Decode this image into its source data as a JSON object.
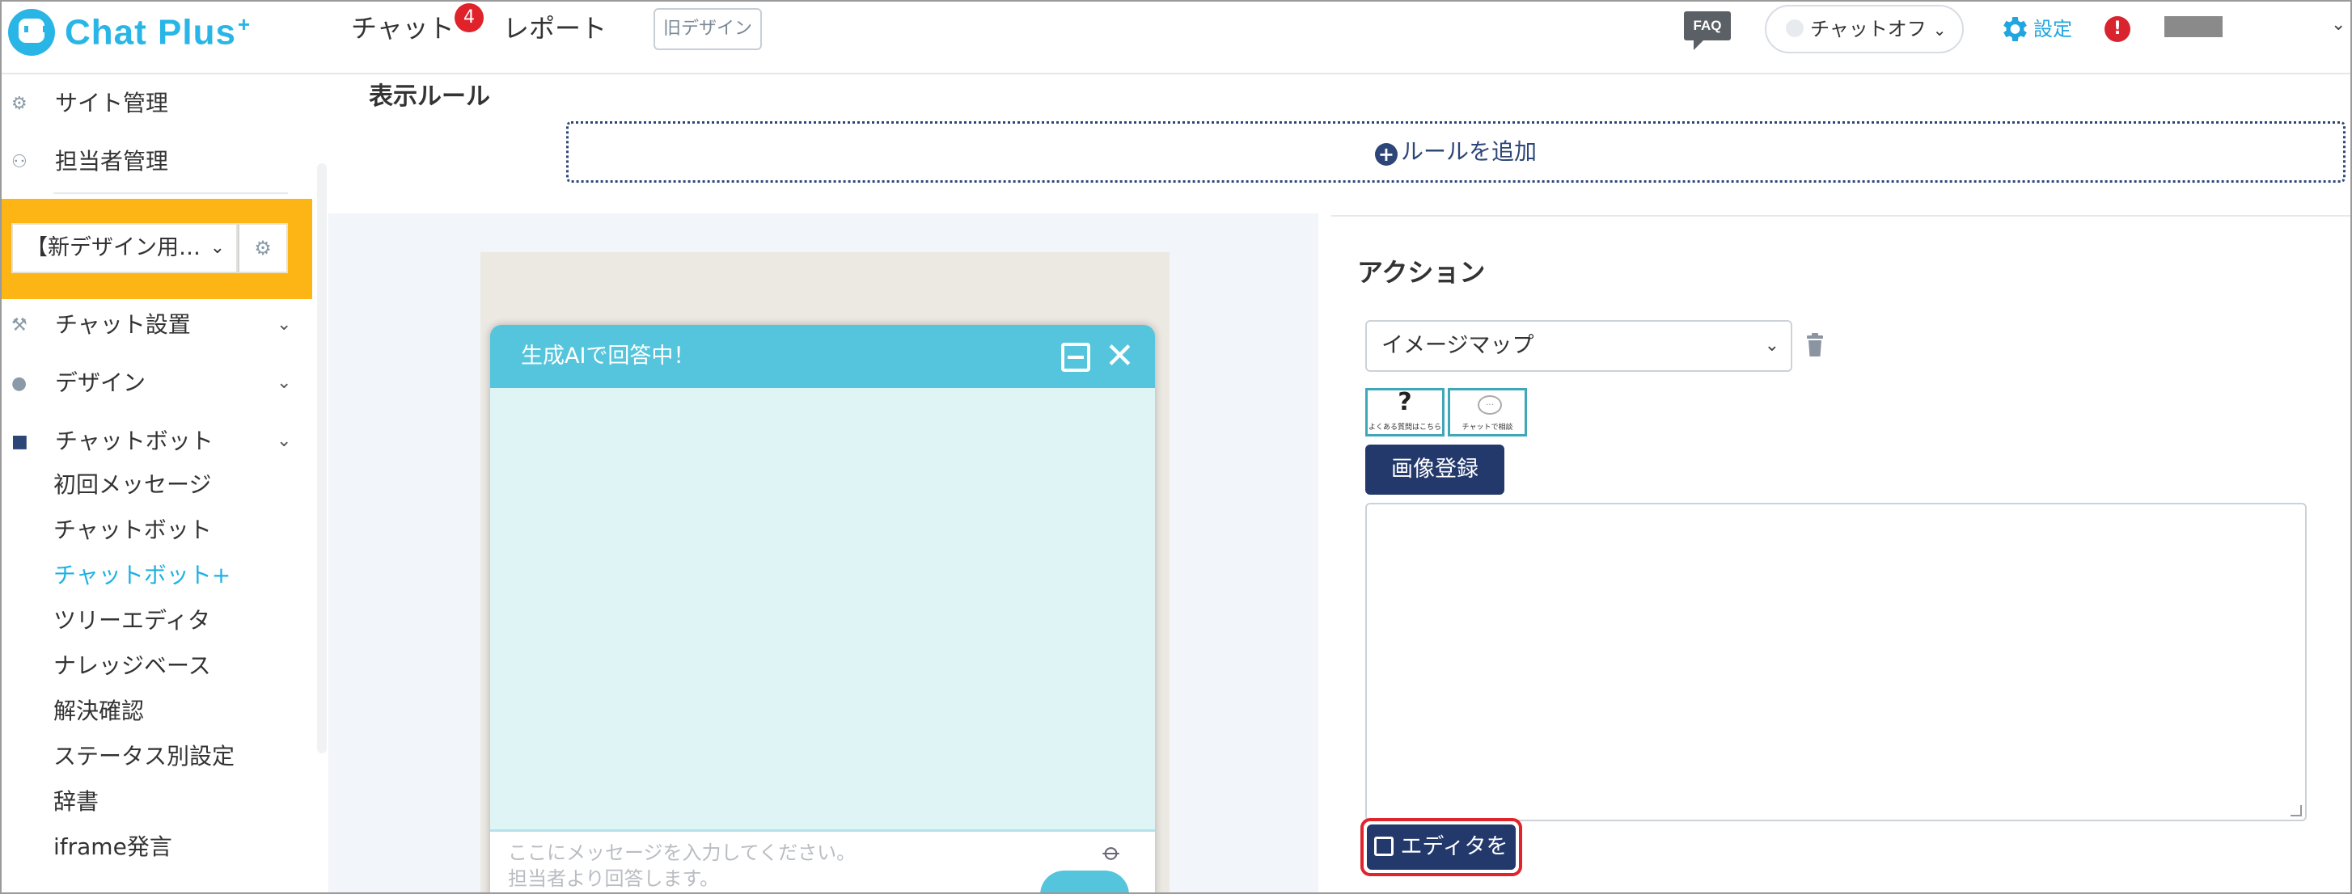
{
  "header": {
    "logo": "Chat Plus",
    "logo_plus": "+",
    "nav_chat": "チャット",
    "nav_chat_badge": "4",
    "nav_report": "レポート",
    "old_design": "旧デザイン",
    "faq": "FAQ",
    "chat_status": "チャットオフ",
    "settings": "設定",
    "alert": "!"
  },
  "sidebar": {
    "site_manage": "サイト管理",
    "staff_manage": "担当者管理",
    "site_select": "【新デザイン用…",
    "chat_setup": "チャット設置",
    "design": "デザイン",
    "chatbot": "チャットボット",
    "sub_items": [
      "初回メッセージ",
      "チャットボット",
      "チャットボット+",
      "ツリーエディタ",
      "ナレッジベース",
      "解決確認",
      "ステータス別設定",
      "辞書",
      "iframe発言"
    ]
  },
  "main": {
    "display_rules_title": "表示ルール",
    "add_rule": "ルールを追加",
    "preview": {
      "header": "生成AIで回答中！",
      "input_placeholder_1": "ここにメッセージを入力してください。",
      "input_placeholder_2": "担当者より回答します。"
    },
    "action": {
      "title": "アクション",
      "select_value": "イメージマップ",
      "thumb1_symbol": "?",
      "thumb1_text": "よくある質問はこちら",
      "thumb2_symbol": "...",
      "thumb2_text": "チャットで相談",
      "image_register": "画像登録",
      "open_editor": "エディタを開く"
    }
  },
  "colors": {
    "brand": "#29b6e6",
    "accent_yellow": "#fdb415",
    "navy_button": "#23386b",
    "chat_header": "#54c5dc",
    "highlight_red": "#e0242b"
  }
}
